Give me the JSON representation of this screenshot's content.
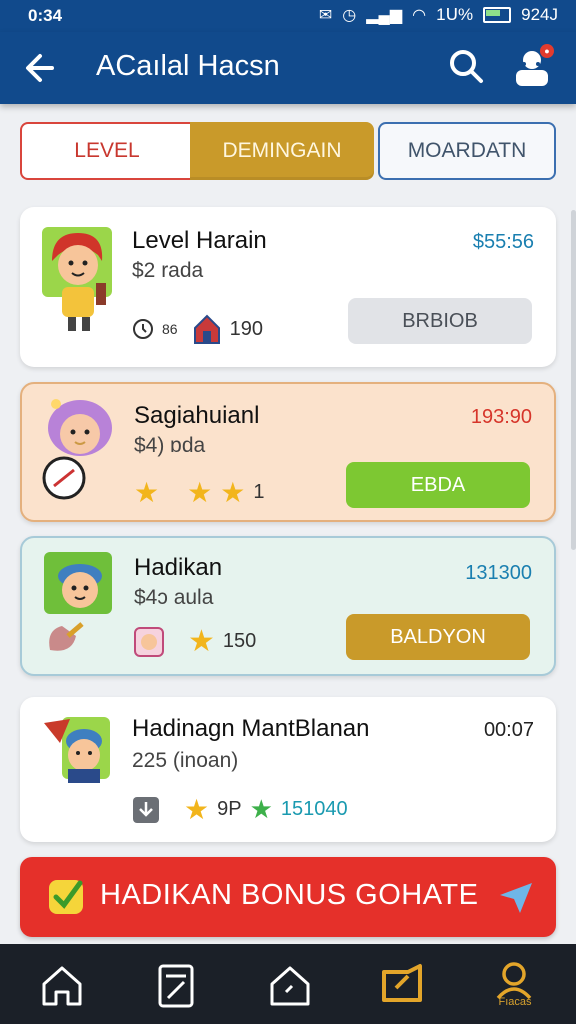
{
  "status_bar": {
    "time": "0:34",
    "battery": "1ᑌ%",
    "clock_right": "924J"
  },
  "app_bar": {
    "title": "ACaılal Hacsn"
  },
  "tabs": [
    {
      "label": "LEVEL"
    },
    {
      "label": "DEMINGAIN"
    },
    {
      "label": "MOARDATN"
    }
  ],
  "cards": [
    {
      "name": "Level Harain",
      "sub": "$2 rada",
      "price": "$55:56",
      "stat1": "86",
      "stat2": "190",
      "action": "BRBIOB"
    },
    {
      "name": "Sagiahuianl",
      "sub": "$4) ɒda",
      "price": "193:90",
      "stat1": "1",
      "action": "EBDA"
    },
    {
      "name": "Hadikan",
      "sub": "$4ɔ aula",
      "price": "131300",
      "stat1": "150",
      "action": "BALDYON"
    },
    {
      "name": "Hadinagn MantBlanan",
      "sub": "225 (inoan)",
      "price": "00:07",
      "stat1": "9P",
      "stat2": "151040"
    }
  ],
  "bonus": {
    "label": "HADIKAN BONUS GOHATE"
  },
  "bottom_nav": {
    "profile_label": "Fıacas"
  },
  "colors": {
    "primary": "#114a8c",
    "gold": "#c99a2a",
    "red": "#e5302a",
    "green": "#7dc832",
    "price_blue": "#1a7fb0",
    "price_red": "#d6352a"
  }
}
